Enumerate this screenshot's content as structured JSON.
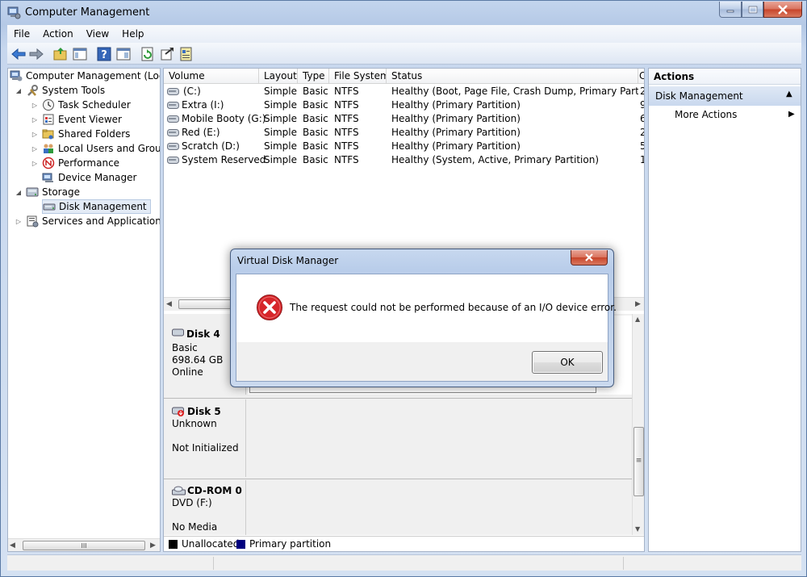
{
  "window": {
    "title": "Computer Management"
  },
  "menu": [
    "File",
    "Action",
    "View",
    "Help"
  ],
  "toolbar": {
    "icons": [
      "back-icon",
      "forward-icon",
      "up-folder-icon",
      "show-hide-tree-icon",
      "help-icon",
      "properties-icon",
      "refresh-icon",
      "export-icon",
      "properties-sheet-icon"
    ]
  },
  "tree": {
    "root": "Computer Management (Local",
    "system_tools": "System Tools",
    "task_scheduler": "Task Scheduler",
    "event_viewer": "Event Viewer",
    "shared_folders": "Shared Folders",
    "local_users": "Local Users and Groups",
    "performance": "Performance",
    "device_manager": "Device Manager",
    "storage": "Storage",
    "disk_management": "Disk Management",
    "services": "Services and Applications"
  },
  "volume_table": {
    "headers": [
      "Volume",
      "Layout",
      "Type",
      "File System",
      "Status",
      "C"
    ],
    "rows": [
      {
        "volume": "(C:)",
        "layout": "Simple",
        "type": "Basic",
        "fs": "NTFS",
        "status": "Healthy (Boot, Page File, Crash Dump, Primary Partition)",
        "cap": "2"
      },
      {
        "volume": "Extra (I:)",
        "layout": "Simple",
        "type": "Basic",
        "fs": "NTFS",
        "status": "Healthy (Primary Partition)",
        "cap": "9"
      },
      {
        "volume": "Mobile Booty (G:)",
        "layout": "Simple",
        "type": "Basic",
        "fs": "NTFS",
        "status": "Healthy (Primary Partition)",
        "cap": "6"
      },
      {
        "volume": "Red (E:)",
        "layout": "Simple",
        "type": "Basic",
        "fs": "NTFS",
        "status": "Healthy (Primary Partition)",
        "cap": "2"
      },
      {
        "volume": "Scratch (D:)",
        "layout": "Simple",
        "type": "Basic",
        "fs": "NTFS",
        "status": "Healthy (Primary Partition)",
        "cap": "5"
      },
      {
        "volume": "System Reserved",
        "layout": "Simple",
        "type": "Basic",
        "fs": "NTFS",
        "status": "Healthy (System, Active, Primary Partition)",
        "cap": "1"
      }
    ]
  },
  "disks": {
    "disk4": {
      "name": "Disk 4",
      "kind": "Basic",
      "size": "698.64 GB",
      "state": "Online"
    },
    "disk5": {
      "name": "Disk 5",
      "kind": "Unknown",
      "state": "Not Initialized"
    },
    "cdrom": {
      "name": "CD-ROM 0",
      "kind": "DVD (F:)",
      "state": "No Media"
    }
  },
  "legend": {
    "unallocated": "Unallocated",
    "primary": "Primary partition",
    "unallocated_color": "#000000",
    "primary_color": "#00007f"
  },
  "actions": {
    "title": "Actions",
    "section": "Disk Management",
    "more": "More Actions"
  },
  "dialog": {
    "title": "Virtual Disk Manager",
    "message": "The request could not be performed because of an I/O device error.",
    "ok": "OK"
  },
  "scroll": {
    "thumb": "III",
    "grip": "≡"
  }
}
